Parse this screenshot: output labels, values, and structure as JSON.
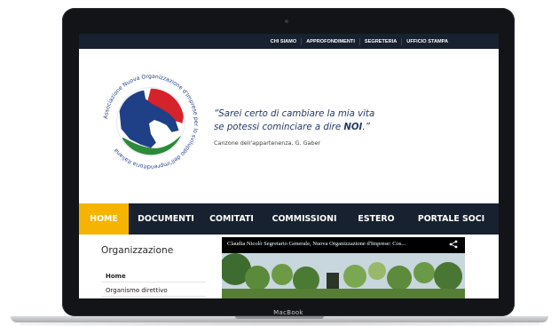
{
  "device": {
    "label": "MacBook"
  },
  "site": {
    "top_nav": [
      "CHI SIAMO",
      "APPROFONDIMENTI",
      "SEGRETERIA",
      "UFFICIO STAMPA"
    ],
    "logo": {
      "ring_text": "Associazione Nuova Organizzazione d'Imprese per lo sviluppo dell'imprenditoria italiana",
      "colors": {
        "blue": "#1f3f86",
        "green": "#2d8a3a",
        "red": "#d4232b"
      }
    },
    "quote": {
      "line1": "“Sarei certo di cambiare la mia vita",
      "line2_pre": "se potessi cominciare a dire ",
      "line2_bold": "NOI",
      "line2_post": ".”",
      "source": "Canzone dell’appartenenza, G. Gaber"
    },
    "main_nav": [
      {
        "label": "HOME",
        "active": true
      },
      {
        "label": "DOCUMENTI",
        "active": false
      },
      {
        "label": "COMITATI",
        "active": false
      },
      {
        "label": "COMMISSIONI",
        "active": false
      },
      {
        "label": "ESTERO",
        "active": false
      },
      {
        "label": "PORTALE SOCI",
        "active": false
      }
    ],
    "sidebar": {
      "title": "Organizzazione",
      "items": [
        "Home",
        "Organismo direttivo"
      ]
    },
    "video": {
      "title": "Claudia Nicolò Segretario Generale, Nuova Organizzazione d'Imprese: Cos...",
      "share_icon": "share-icon"
    }
  },
  "colors": {
    "nav_bg": "#17212f",
    "accent": "#f6b400",
    "quote_text": "#243a66"
  }
}
